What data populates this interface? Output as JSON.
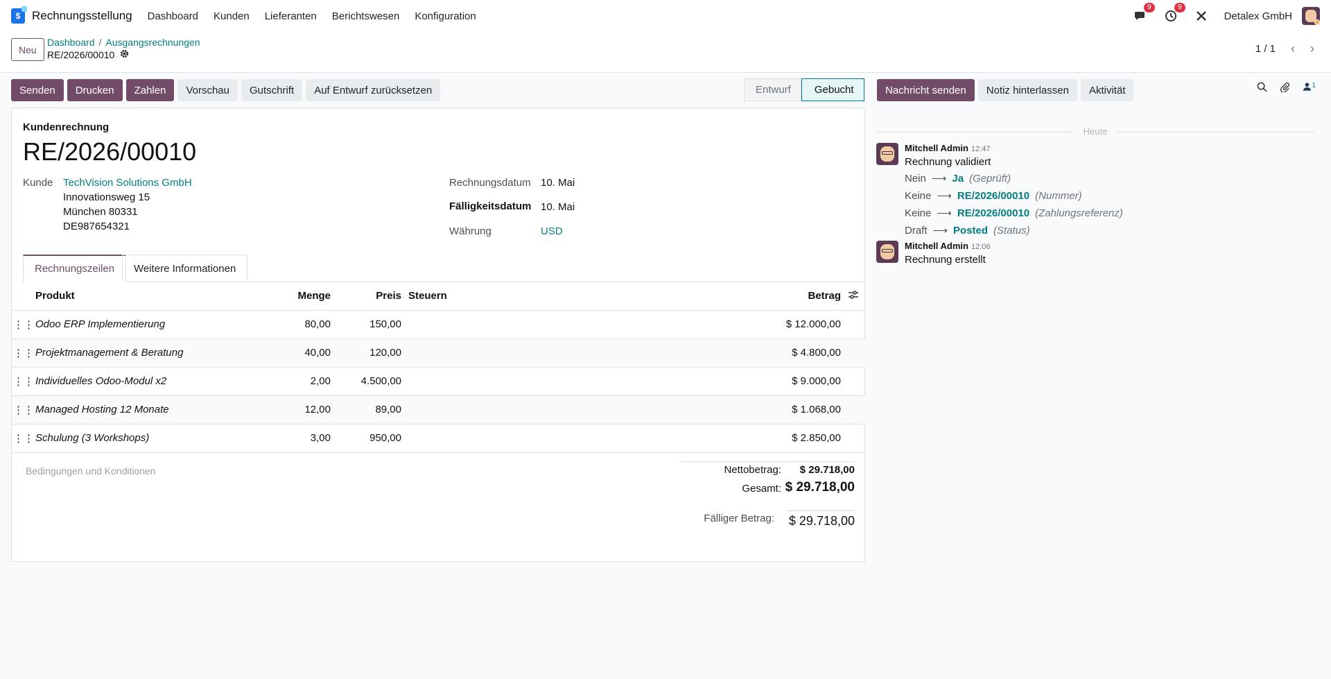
{
  "navbar": {
    "app_name": "Rechnungsstellung",
    "menu": [
      "Dashboard",
      "Kunden",
      "Lieferanten",
      "Berichtswesen",
      "Konfiguration"
    ],
    "messages_badge": "9",
    "activities_badge": "9",
    "company": "Detalex GmbH"
  },
  "control": {
    "new_label": "Neu",
    "breadcrumb": [
      "Dashboard",
      "Ausgangsrechnungen"
    ],
    "record_name": "RE/2026/00010",
    "pager": "1 / 1"
  },
  "actions": {
    "send": "Senden",
    "print": "Drucken",
    "pay": "Zahlen",
    "preview": "Vorschau",
    "credit_note": "Gutschrift",
    "reset_draft": "Auf Entwurf zurücksetzen"
  },
  "statusbar": {
    "draft": "Entwurf",
    "posted": "Gebucht"
  },
  "chatter_actions": {
    "send_message": "Nachricht senden",
    "log_note": "Notiz hinterlassen",
    "activity": "Aktivität",
    "followers": "1"
  },
  "invoice": {
    "type": "Kundenrechnung",
    "number": "RE/2026/00010",
    "customer_label": "Kunde",
    "customer_name": "TechVision Solutions GmbH",
    "address": [
      "Innovationsweg 15",
      "München 80331",
      "DE987654321"
    ],
    "invoice_date_label": "Rechnungsdatum",
    "invoice_date": "10. Mai",
    "due_date_label": "Fälligkeitsdatum",
    "due_date": "10. Mai",
    "currency_label": "Währung",
    "currency": "USD"
  },
  "tabs": {
    "lines": "Rechnungszeilen",
    "other": "Weitere Informationen"
  },
  "lines": {
    "headers": {
      "product": "Produkt",
      "qty": "Menge",
      "price": "Preis",
      "taxes": "Steuern",
      "amount": "Betrag"
    },
    "rows": [
      {
        "product": "Odoo ERP Implementierung",
        "qty": "80,00",
        "price": "150,00",
        "amount": "$ 12.000,00"
      },
      {
        "product": "Projektmanagement & Beratung",
        "qty": "40,00",
        "price": "120,00",
        "amount": "$ 4.800,00"
      },
      {
        "product": "Individuelles Odoo-Modul x2",
        "qty": "2,00",
        "price": "4.500,00",
        "amount": "$ 9.000,00"
      },
      {
        "product": "Managed Hosting 12 Monate",
        "qty": "12,00",
        "price": "89,00",
        "amount": "$ 1.068,00"
      },
      {
        "product": "Schulung (3 Workshops)",
        "qty": "3,00",
        "price": "950,00",
        "amount": "$ 2.850,00"
      }
    ]
  },
  "terms_placeholder": "Bedingungen und Konditionen",
  "totals": {
    "net_label": "Nettobetrag:",
    "net": "$ 29.718,00",
    "total_label": "Gesamt:",
    "total": "$ 29.718,00",
    "due_label": "Fälliger Betrag:",
    "due": "$ 29.718,00"
  },
  "chatter": {
    "today": "Heute",
    "messages": [
      {
        "author": "Mitchell Admin",
        "time": "12:47",
        "body": "Rechnung validiert",
        "tracking": [
          {
            "old": "Nein",
            "new": "Ja",
            "field": "(Geprüft)"
          },
          {
            "old": "Keine",
            "new": "RE/2026/00010",
            "field": "(Nummer)"
          },
          {
            "old": "Keine",
            "new": "RE/2026/00010",
            "field": "(Zahlungsreferenz)"
          },
          {
            "old": "Draft",
            "new": "Posted",
            "field": "(Status)"
          }
        ]
      },
      {
        "author": "Mitchell Admin",
        "time": "12:06",
        "body": "Rechnung erstellt"
      }
    ]
  }
}
